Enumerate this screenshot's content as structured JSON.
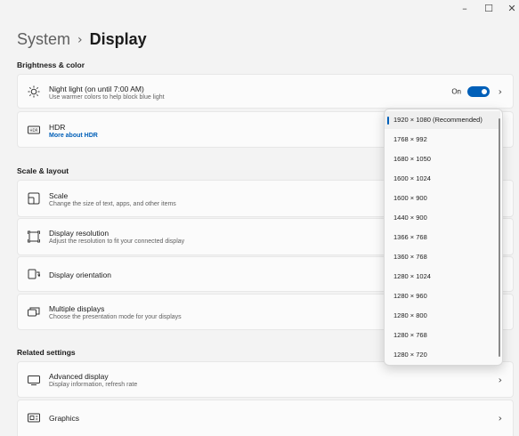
{
  "window": {
    "minimize": "–",
    "maximize": "☐",
    "close": "✕"
  },
  "breadcrumb": {
    "parent": "System",
    "separator": "›",
    "current": "Display"
  },
  "sections": {
    "brightness": "Brightness & color",
    "scale": "Scale & layout",
    "related": "Related settings"
  },
  "night_light": {
    "title": "Night light (on until 7:00 AM)",
    "desc": "Use warmer colors to help block blue light",
    "toggle_label": "On",
    "toggle_on": true
  },
  "hdr": {
    "title": "HDR",
    "link": "More about HDR"
  },
  "scale": {
    "title": "Scale",
    "desc": "Change the size of text, apps, and other items"
  },
  "resolution": {
    "title": "Display resolution",
    "desc": "Adjust the resolution to fit your connected display"
  },
  "orientation": {
    "title": "Display orientation"
  },
  "multiple": {
    "title": "Multiple displays",
    "desc": "Choose the presentation mode for your displays"
  },
  "advanced": {
    "title": "Advanced display",
    "desc": "Display information, refresh rate"
  },
  "graphics": {
    "title": "Graphics"
  },
  "resolution_dropdown": {
    "options": [
      "1920 × 1080 (Recommended)",
      "1768 × 992",
      "1680 × 1050",
      "1600 × 1024",
      "1600 × 900",
      "1440 × 900",
      "1366 × 768",
      "1360 × 768",
      "1280 × 1024",
      "1280 × 960",
      "1280 × 800",
      "1280 × 768",
      "1280 × 720"
    ],
    "selected_index": 0
  },
  "colors": {
    "accent": "#005fb8",
    "background": "#f3f3f3",
    "card": "#fbfbfb"
  },
  "icons": {
    "night_light": "sun-icon",
    "hdr": "hdr-icon",
    "scale": "scale-icon",
    "resolution": "resolution-icon",
    "orientation": "orientation-icon",
    "multiple": "multiple-displays-icon",
    "advanced": "monitor-icon",
    "graphics": "graphics-icon",
    "chevron": "chevron-right-icon"
  }
}
